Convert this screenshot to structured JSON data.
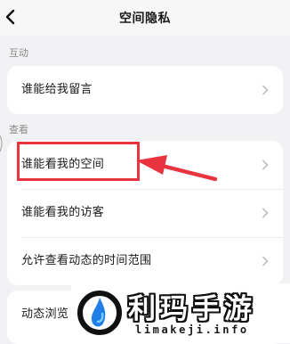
{
  "header": {
    "title": "空间隐私"
  },
  "sections": [
    {
      "label": "互动",
      "items": [
        {
          "label": "谁能给我留言"
        }
      ]
    },
    {
      "label": "查看",
      "items": [
        {
          "label": "谁能看我的空间"
        },
        {
          "label": "谁能看我的访客"
        },
        {
          "label": "允许查看动态的时间范围"
        }
      ]
    }
  ],
  "partial_row": {
    "label": "动态浏览"
  },
  "watermark": {
    "brand": "利玛手游",
    "url": "limakeji.info"
  },
  "colors": {
    "accent": "#e8343e",
    "background": "#f2f2f4",
    "card": "#ffffff"
  },
  "icons": {
    "back": "chevron-left-icon",
    "row": "chevron-right-icon",
    "watermark_logo": "crescent-drop-logo-icon"
  }
}
